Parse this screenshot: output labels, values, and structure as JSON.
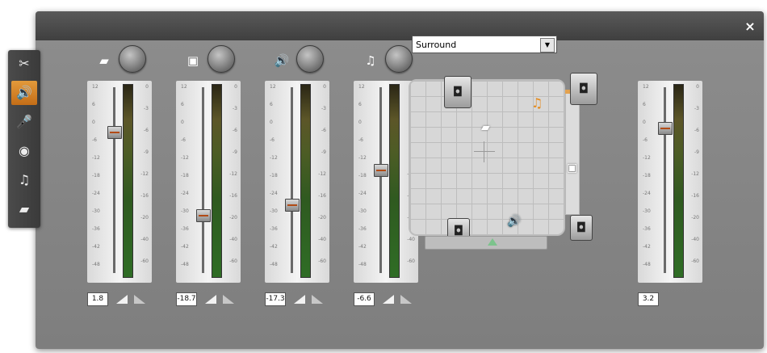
{
  "window": {
    "close_glyph": "×"
  },
  "toolbar": {
    "tools": [
      {
        "name": "scissors-icon",
        "glyph": "✂"
      },
      {
        "name": "audio-volume-icon",
        "glyph": "🔊"
      },
      {
        "name": "microphone-icon",
        "glyph": "🎤"
      },
      {
        "name": "disc-icon",
        "glyph": "◉"
      },
      {
        "name": "music-note-icon",
        "glyph": "♫"
      },
      {
        "name": "camera-icon",
        "glyph": "▰"
      }
    ]
  },
  "scale_left": [
    "12",
    "6",
    "0",
    "-6",
    "-12",
    "-18",
    "-24",
    "-30",
    "-36",
    "-42",
    "-48"
  ],
  "scale_right": [
    "0",
    "-3",
    "-6",
    "-9",
    "-12",
    "-16",
    "-20",
    "-40",
    "-60"
  ],
  "channels": [
    {
      "name": "video-audio",
      "icon": "camera-icon",
      "glyph": "▰",
      "value": "1.8",
      "fader_level": 0.78
    },
    {
      "name": "narration",
      "icon": "disc-icon",
      "glyph": "▣",
      "value": "-18.7",
      "fader_level": 0.3
    },
    {
      "name": "sound-effects",
      "icon": "speaker-icon",
      "glyph": "🔊",
      "value": "-17.3",
      "fader_level": 0.36
    },
    {
      "name": "music",
      "icon": "music-note-icon",
      "glyph": "♫",
      "value": "-6.6",
      "fader_level": 0.56
    }
  ],
  "master": {
    "value": "3.2",
    "fader_level": 0.8
  },
  "surround": {
    "selected": "Surround",
    "dropdown_glyph": "▼"
  }
}
